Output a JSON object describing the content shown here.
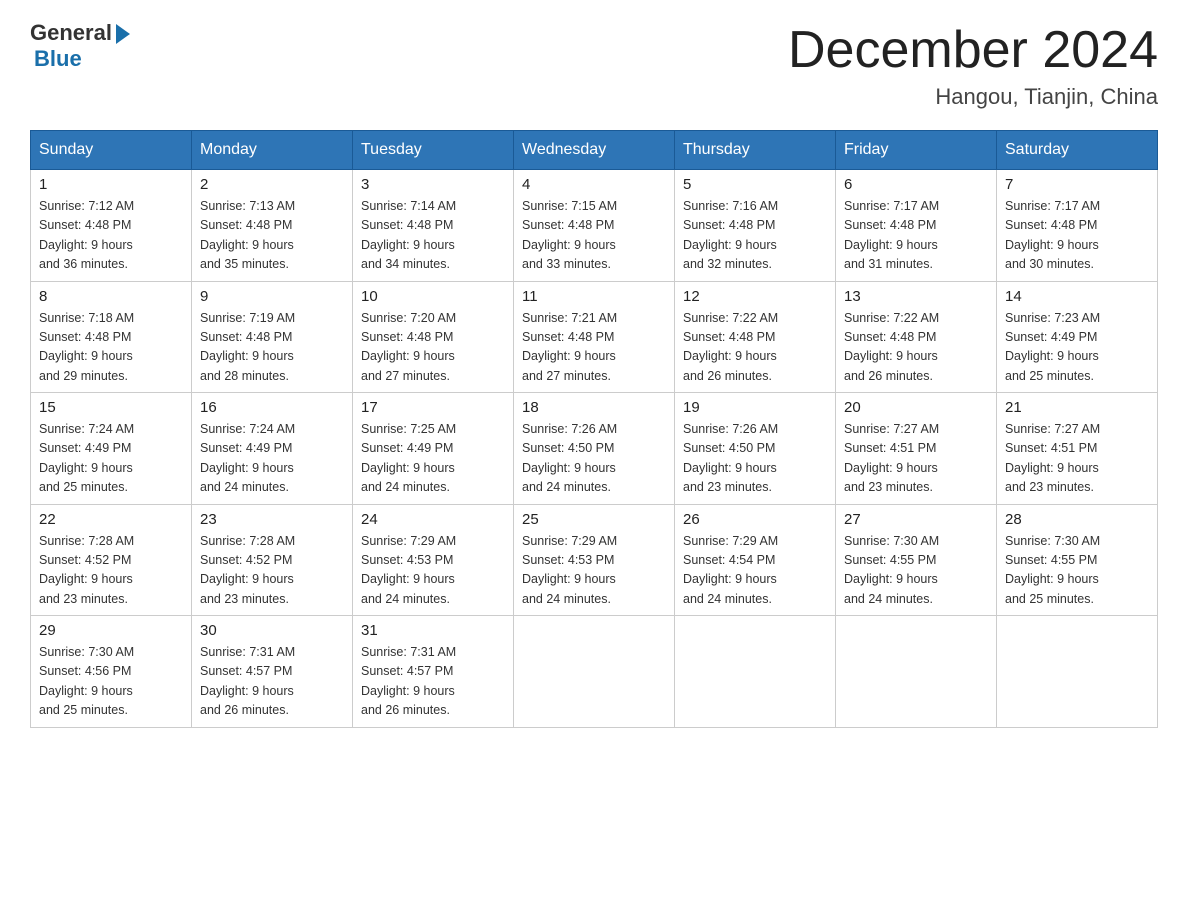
{
  "logo": {
    "general": "General",
    "blue": "Blue"
  },
  "title": "December 2024",
  "location": "Hangou, Tianjin, China",
  "days_of_week": [
    "Sunday",
    "Monday",
    "Tuesday",
    "Wednesday",
    "Thursday",
    "Friday",
    "Saturday"
  ],
  "weeks": [
    [
      {
        "day": "1",
        "sunrise": "7:12 AM",
        "sunset": "4:48 PM",
        "daylight": "9 hours and 36 minutes."
      },
      {
        "day": "2",
        "sunrise": "7:13 AM",
        "sunset": "4:48 PM",
        "daylight": "9 hours and 35 minutes."
      },
      {
        "day": "3",
        "sunrise": "7:14 AM",
        "sunset": "4:48 PM",
        "daylight": "9 hours and 34 minutes."
      },
      {
        "day": "4",
        "sunrise": "7:15 AM",
        "sunset": "4:48 PM",
        "daylight": "9 hours and 33 minutes."
      },
      {
        "day": "5",
        "sunrise": "7:16 AM",
        "sunset": "4:48 PM",
        "daylight": "9 hours and 32 minutes."
      },
      {
        "day": "6",
        "sunrise": "7:17 AM",
        "sunset": "4:48 PM",
        "daylight": "9 hours and 31 minutes."
      },
      {
        "day": "7",
        "sunrise": "7:17 AM",
        "sunset": "4:48 PM",
        "daylight": "9 hours and 30 minutes."
      }
    ],
    [
      {
        "day": "8",
        "sunrise": "7:18 AM",
        "sunset": "4:48 PM",
        "daylight": "9 hours and 29 minutes."
      },
      {
        "day": "9",
        "sunrise": "7:19 AM",
        "sunset": "4:48 PM",
        "daylight": "9 hours and 28 minutes."
      },
      {
        "day": "10",
        "sunrise": "7:20 AM",
        "sunset": "4:48 PM",
        "daylight": "9 hours and 27 minutes."
      },
      {
        "day": "11",
        "sunrise": "7:21 AM",
        "sunset": "4:48 PM",
        "daylight": "9 hours and 27 minutes."
      },
      {
        "day": "12",
        "sunrise": "7:22 AM",
        "sunset": "4:48 PM",
        "daylight": "9 hours and 26 minutes."
      },
      {
        "day": "13",
        "sunrise": "7:22 AM",
        "sunset": "4:48 PM",
        "daylight": "9 hours and 26 minutes."
      },
      {
        "day": "14",
        "sunrise": "7:23 AM",
        "sunset": "4:49 PM",
        "daylight": "9 hours and 25 minutes."
      }
    ],
    [
      {
        "day": "15",
        "sunrise": "7:24 AM",
        "sunset": "4:49 PM",
        "daylight": "9 hours and 25 minutes."
      },
      {
        "day": "16",
        "sunrise": "7:24 AM",
        "sunset": "4:49 PM",
        "daylight": "9 hours and 24 minutes."
      },
      {
        "day": "17",
        "sunrise": "7:25 AM",
        "sunset": "4:49 PM",
        "daylight": "9 hours and 24 minutes."
      },
      {
        "day": "18",
        "sunrise": "7:26 AM",
        "sunset": "4:50 PM",
        "daylight": "9 hours and 24 minutes."
      },
      {
        "day": "19",
        "sunrise": "7:26 AM",
        "sunset": "4:50 PM",
        "daylight": "9 hours and 23 minutes."
      },
      {
        "day": "20",
        "sunrise": "7:27 AM",
        "sunset": "4:51 PM",
        "daylight": "9 hours and 23 minutes."
      },
      {
        "day": "21",
        "sunrise": "7:27 AM",
        "sunset": "4:51 PM",
        "daylight": "9 hours and 23 minutes."
      }
    ],
    [
      {
        "day": "22",
        "sunrise": "7:28 AM",
        "sunset": "4:52 PM",
        "daylight": "9 hours and 23 minutes."
      },
      {
        "day": "23",
        "sunrise": "7:28 AM",
        "sunset": "4:52 PM",
        "daylight": "9 hours and 23 minutes."
      },
      {
        "day": "24",
        "sunrise": "7:29 AM",
        "sunset": "4:53 PM",
        "daylight": "9 hours and 24 minutes."
      },
      {
        "day": "25",
        "sunrise": "7:29 AM",
        "sunset": "4:53 PM",
        "daylight": "9 hours and 24 minutes."
      },
      {
        "day": "26",
        "sunrise": "7:29 AM",
        "sunset": "4:54 PM",
        "daylight": "9 hours and 24 minutes."
      },
      {
        "day": "27",
        "sunrise": "7:30 AM",
        "sunset": "4:55 PM",
        "daylight": "9 hours and 24 minutes."
      },
      {
        "day": "28",
        "sunrise": "7:30 AM",
        "sunset": "4:55 PM",
        "daylight": "9 hours and 25 minutes."
      }
    ],
    [
      {
        "day": "29",
        "sunrise": "7:30 AM",
        "sunset": "4:56 PM",
        "daylight": "9 hours and 25 minutes."
      },
      {
        "day": "30",
        "sunrise": "7:31 AM",
        "sunset": "4:57 PM",
        "daylight": "9 hours and 26 minutes."
      },
      {
        "day": "31",
        "sunrise": "7:31 AM",
        "sunset": "4:57 PM",
        "daylight": "9 hours and 26 minutes."
      },
      null,
      null,
      null,
      null
    ]
  ],
  "labels": {
    "sunrise": "Sunrise:",
    "sunset": "Sunset:",
    "daylight": "Daylight:"
  }
}
